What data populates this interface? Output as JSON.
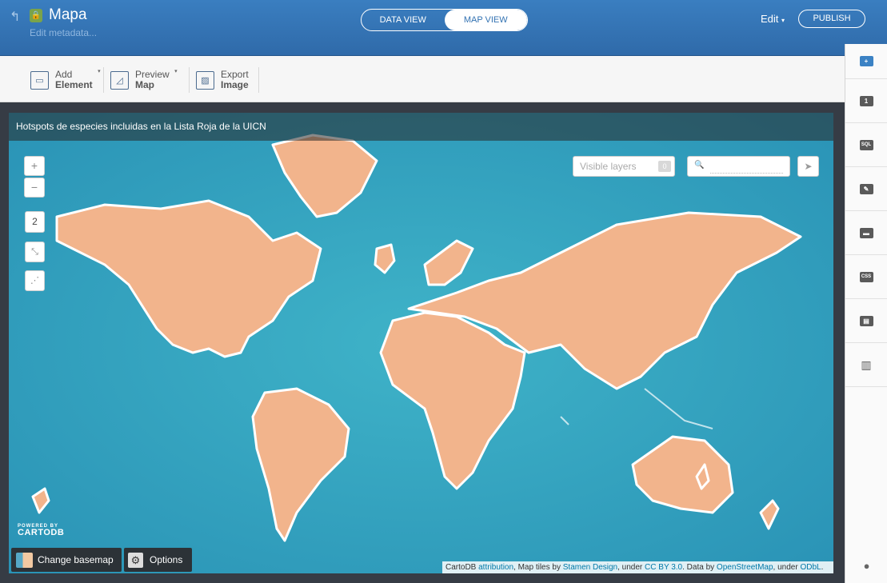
{
  "header": {
    "title": "Mapa",
    "edit_metadata": "Edit metadata...",
    "view_tabs": [
      "DATA VIEW",
      "MAP VIEW"
    ],
    "active_tab": "MAP VIEW",
    "edit_label": "Edit",
    "publish_label": "PUBLISH",
    "colors": {
      "header": "#3574b5"
    }
  },
  "toolbar": {
    "items": [
      {
        "line1": "Add",
        "line2": "Element",
        "icon": "add-element-icon"
      },
      {
        "line1": "Preview",
        "line2": "Map",
        "icon": "preview-map-icon"
      },
      {
        "line1": "Export",
        "line2": "Image",
        "icon": "export-image-icon"
      }
    ]
  },
  "map": {
    "title": "Hotspots de especies incluidas en la Lista Roja de la UICN",
    "zoom_in": "+",
    "zoom_out": "−",
    "layer_count": "2",
    "visible_layers_label": "Visible layers",
    "visible_layers_count": "0",
    "powered_small": "POWERED BY",
    "powered_big": "CARTODB",
    "change_basemap": "Change basemap",
    "options": "Options",
    "attribution": {
      "pre": "CartoDB ",
      "l1": "attribution",
      "mid1": ", Map tiles by ",
      "l2": "Stamen Design",
      "mid2": ", under ",
      "l3": "CC BY 3.0",
      "mid3": ". Data by ",
      "l4": "OpenStreetMap",
      "mid4": ", under ",
      "l5": "ODbL",
      "end": "."
    }
  },
  "sidebar": {
    "items": [
      {
        "label": "+",
        "icon": "add-layer-icon"
      },
      {
        "label": "1",
        "icon": "layer-1-icon"
      },
      {
        "label": "SQL",
        "icon": "sql-icon"
      },
      {
        "label": "",
        "icon": "wizard-icon"
      },
      {
        "label": "",
        "icon": "infowindow-icon"
      },
      {
        "label": "CSS",
        "icon": "css-icon"
      },
      {
        "label": "",
        "icon": "legend-icon"
      },
      {
        "label": "",
        "icon": "filters-icon"
      }
    ]
  }
}
